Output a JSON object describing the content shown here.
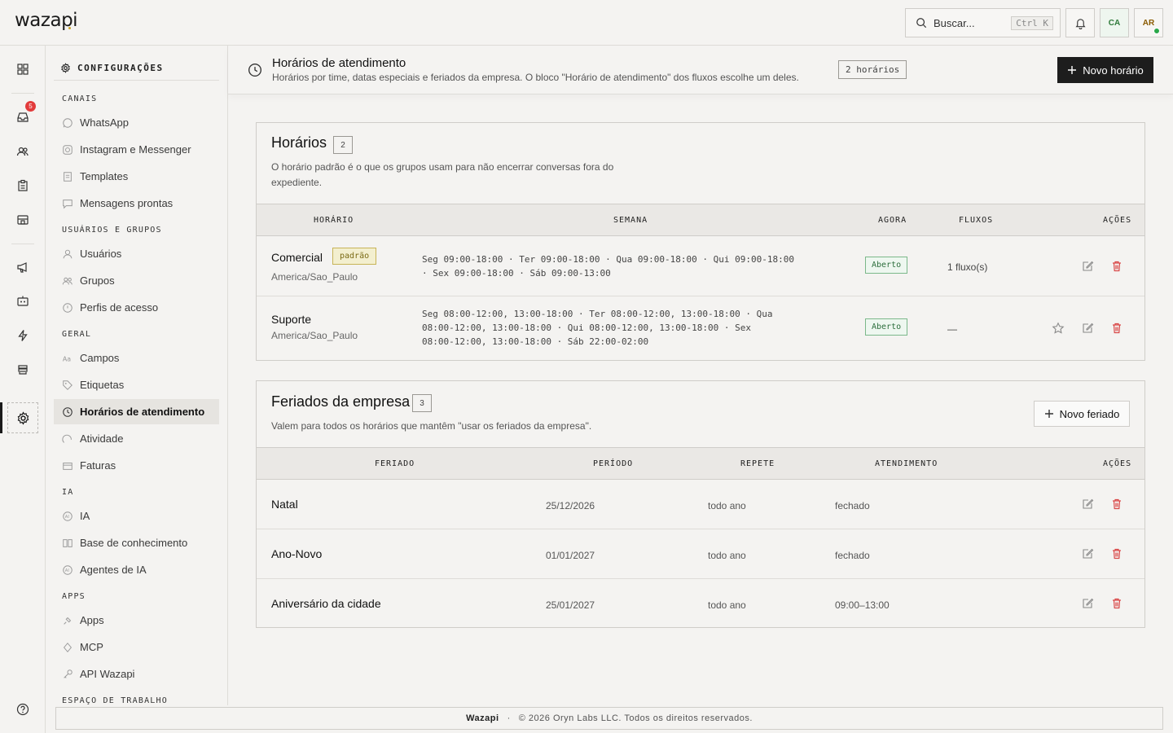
{
  "app": {
    "logo": "wazapi"
  },
  "search": {
    "placeholder": "Buscar...",
    "shortcut": "Ctrl K"
  },
  "topbar": {
    "avatar_ca": "CA",
    "avatar_ar": "AR"
  },
  "rail": {
    "inbox_badge": "5"
  },
  "sidebar": {
    "header": "CONFIGURAÇÕES",
    "sections": {
      "canais": "CANAIS",
      "usuarios": "USUÁRIOS E GRUPOS",
      "geral": "GERAL",
      "ia": "IA",
      "apps": "APPS",
      "espaco": "ESPAÇO DE TRABALHO"
    },
    "items": [
      {
        "label": "WhatsApp",
        "icon": "whatsapp-icon"
      },
      {
        "label": "Instagram e Messenger",
        "icon": "instagram-icon"
      },
      {
        "label": "Templates",
        "icon": "template-icon"
      },
      {
        "label": "Mensagens prontas",
        "icon": "quick-reply-icon"
      },
      {
        "label": "Usuários",
        "icon": "user-icon"
      },
      {
        "label": "Grupos",
        "icon": "group-icon"
      },
      {
        "label": "Perfis de acesso",
        "icon": "shield-icon"
      },
      {
        "label": "Campos",
        "icon": "field-icon"
      },
      {
        "label": "Etiquetas",
        "icon": "tag-icon"
      },
      {
        "label": "Horários de atendimento",
        "icon": "clock-icon"
      },
      {
        "label": "Atividade",
        "icon": "activity-icon"
      },
      {
        "label": "Faturas",
        "icon": "card-icon"
      },
      {
        "label": "IA",
        "icon": "ai-icon"
      },
      {
        "label": "Base de conhecimento",
        "icon": "book-icon"
      },
      {
        "label": "Agentes de IA",
        "icon": "agent-icon"
      },
      {
        "label": "Apps",
        "icon": "plug-icon"
      },
      {
        "label": "MCP",
        "icon": "mcp-icon"
      },
      {
        "label": "API Wazapi",
        "icon": "key-icon"
      }
    ]
  },
  "page": {
    "title": "Horários de atendimento",
    "subtitle": "Horários por time, datas especiais e feriados da empresa. O bloco \"Horário de atendimento\" dos fluxos escolhe um deles.",
    "count": "2 horários",
    "new_button": "Novo horário"
  },
  "schedules": {
    "title": "Horários",
    "count": "2",
    "description": "O horário padrão é o que os grupos usam para não encerrar conversas fora do expediente.",
    "columns": [
      "HORÁRIO",
      "SEMANA",
      "AGORA",
      "FLUXOS",
      "AÇÕES"
    ],
    "rows": [
      {
        "name": "Comercial",
        "default_label": "padrão",
        "timezone": "America/Sao_Paulo",
        "week": "Seg 09:00-18:00 · Ter 09:00-18:00 · Qua 09:00-18:00 · Qui 09:00-18:00 · Sex 09:00-18:00 · Sáb 09:00-13:00",
        "status": "Aberto",
        "flows": "1 fluxo(s)"
      },
      {
        "name": "Suporte",
        "timezone": "America/Sao_Paulo",
        "week": "Seg 08:00-12:00, 13:00-18:00 · Ter 08:00-12:00, 13:00-18:00 · Qua 08:00-12:00, 13:00-18:00 · Qui 08:00-12:00, 13:00-18:00 · Sex 08:00-12:00, 13:00-18:00 · Sáb 22:00-02:00",
        "status": "Aberto",
        "flows": "—"
      }
    ]
  },
  "holidays": {
    "title": "Feriados da empresa",
    "count": "3",
    "description": "Valem para todos os horários que mantêm \"usar os feriados da empresa\".",
    "new_button": "Novo feriado",
    "columns": [
      "FERIADO",
      "PERÍODO",
      "REPETE",
      "ATENDIMENTO",
      "AÇÕES"
    ],
    "rows": [
      {
        "name": "Natal",
        "period": "25/12/2026",
        "repeat": "todo ano",
        "service": "fechado"
      },
      {
        "name": "Ano-Novo",
        "period": "01/01/2027",
        "repeat": "todo ano",
        "service": "fechado"
      },
      {
        "name": "Aniversário da cidade",
        "period": "25/01/2027",
        "repeat": "todo ano",
        "service": "09:00–13:00"
      }
    ]
  },
  "footer": {
    "brand": "Wazapi",
    "sep": "·",
    "copyright": "© 2026 Oryn Labs LLC. Todos os direitos reservados."
  },
  "colors": {
    "accent_dark": "#1d1d1d",
    "status_open": "#2c6e3c",
    "delete": "#d94848",
    "default_pill": "#f3efcf"
  }
}
